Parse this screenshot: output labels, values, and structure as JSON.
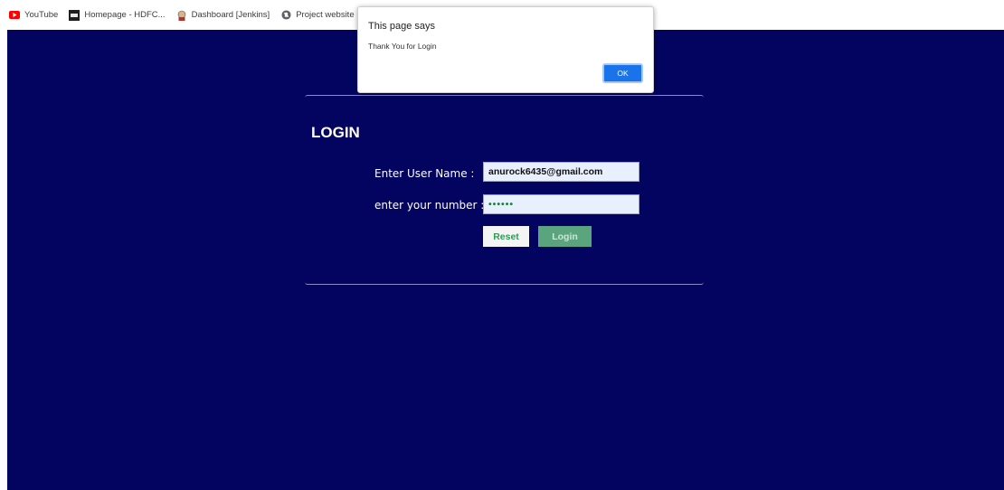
{
  "bookmarks": [
    {
      "label": "YouTube",
      "icon": "youtube-icon"
    },
    {
      "label": "Homepage - HDFC...",
      "icon": "hdfc-icon"
    },
    {
      "label": "Dashboard [Jenkins]",
      "icon": "jenkins-icon"
    },
    {
      "label": "Project website",
      "icon": "globe-icon"
    },
    {
      "label": "",
      "icon": "github-icon"
    }
  ],
  "login": {
    "title": "LOGIN",
    "username_label": "Enter User Name :",
    "username_value": "anurock6435@gmail.com",
    "number_label": "enter your number :",
    "number_value": "••••••",
    "reset_label": "Reset",
    "login_label": "Login"
  },
  "dialog": {
    "title": "This page says",
    "message": "Thank You for Login",
    "ok_label": "OK"
  },
  "colors": {
    "page_background": "#03045f",
    "dialog_button": "#1a73e8",
    "login_button": "#5aa57e"
  }
}
